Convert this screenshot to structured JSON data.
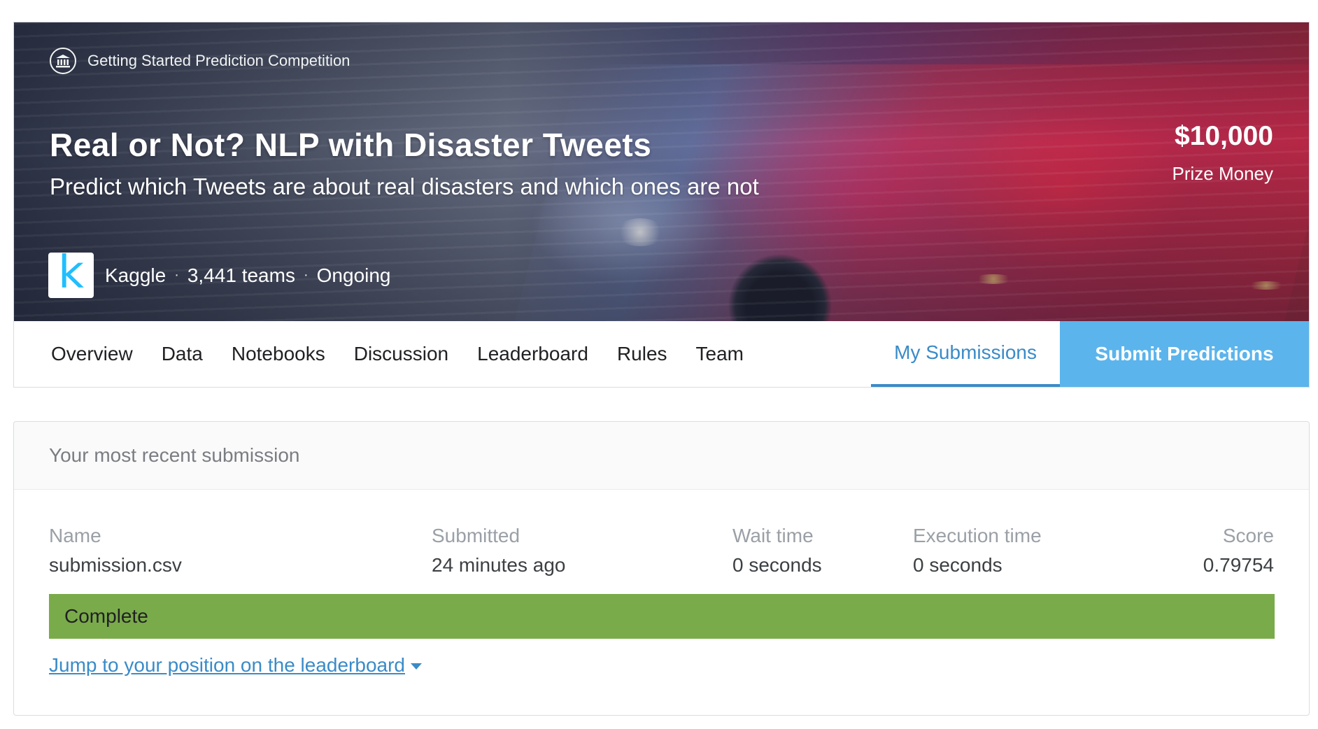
{
  "competition": {
    "type_label": "Getting Started Prediction Competition",
    "title": "Real or Not? NLP with Disaster Tweets",
    "subtitle": "Predict which Tweets are about real disasters and which ones are not",
    "prize_amount": "$10,000",
    "prize_label": "Prize Money",
    "host_logo_letter": "k",
    "host": "Kaggle",
    "teams": "3,441 teams",
    "status": "Ongoing",
    "separator": "·"
  },
  "tabs": {
    "items": [
      {
        "label": "Overview"
      },
      {
        "label": "Data"
      },
      {
        "label": "Notebooks"
      },
      {
        "label": "Discussion"
      },
      {
        "label": "Leaderboard"
      },
      {
        "label": "Rules"
      },
      {
        "label": "Team"
      }
    ],
    "my_submissions": "My Submissions",
    "submit_button": "Submit Predictions"
  },
  "submission": {
    "header": "Your most recent submission",
    "columns": {
      "name": {
        "label": "Name",
        "value": "submission.csv"
      },
      "submitted": {
        "label": "Submitted",
        "value": "24 minutes ago"
      },
      "wait_time": {
        "label": "Wait time",
        "value": "0 seconds"
      },
      "execution_time": {
        "label": "Execution time",
        "value": "0 seconds"
      },
      "score": {
        "label": "Score",
        "value": "0.79754"
      }
    },
    "status": "Complete",
    "jump_link": "Jump to your position on the leaderboard"
  },
  "colors": {
    "accent": "#3a8bc8",
    "submit_button_bg": "#5bb4ec",
    "status_complete": "#7aab4a",
    "kaggle_blue": "#20beff"
  }
}
